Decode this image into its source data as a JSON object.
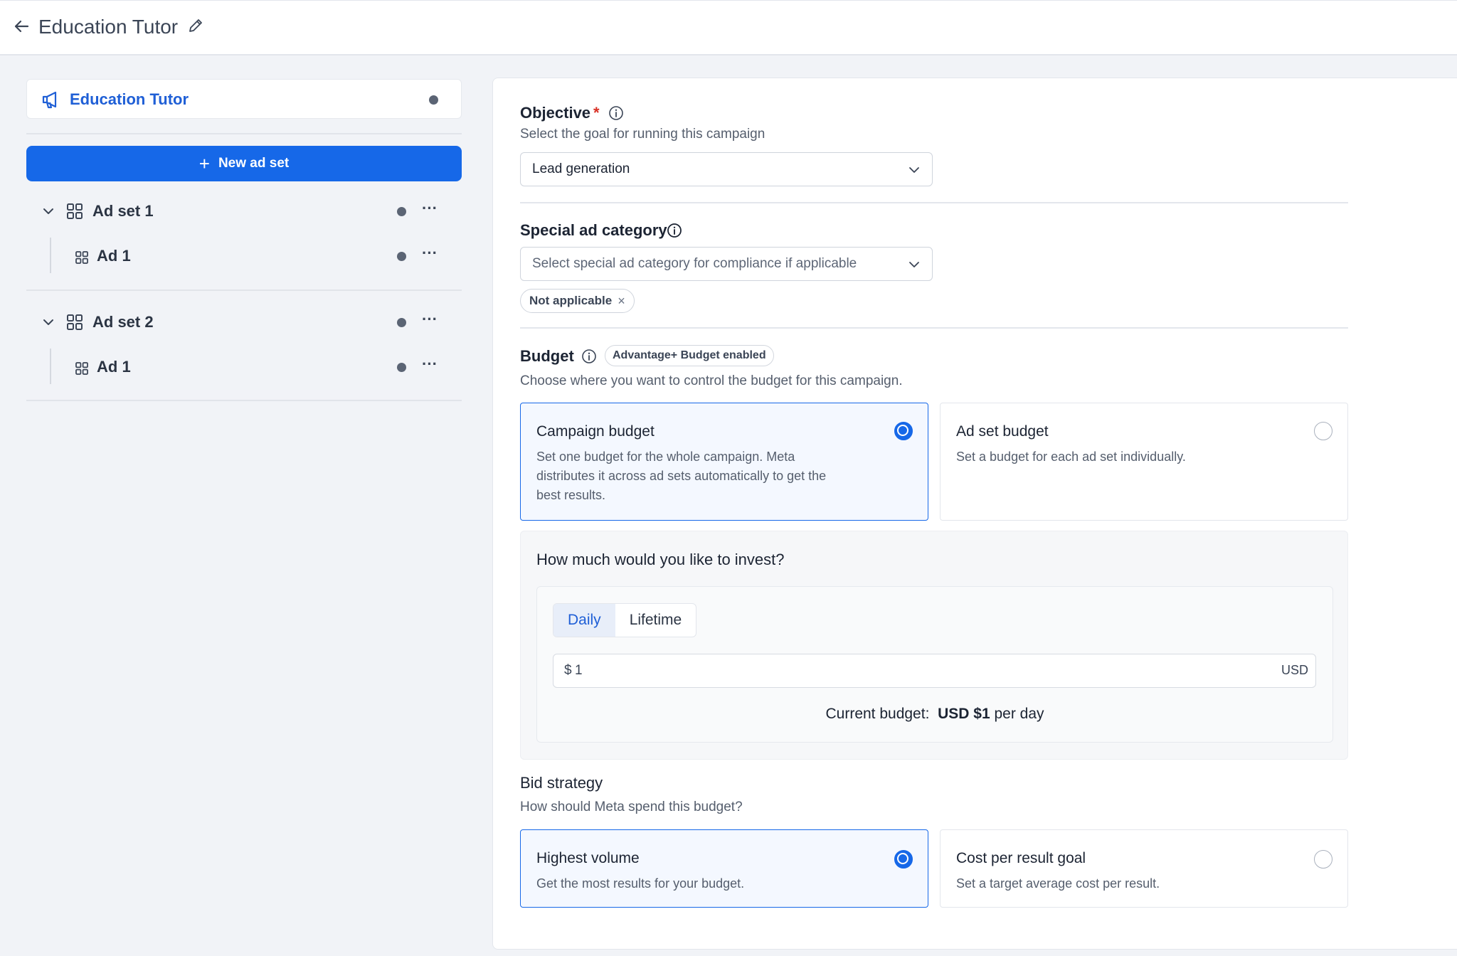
{
  "header": {
    "title": "Education Tutor",
    "back_icon": "arrow-left-icon",
    "edit_icon": "pencil-icon"
  },
  "sidebar": {
    "campaign_name": "Education Tutor",
    "new_ad_set_label": "New ad set",
    "ad_sets": [
      {
        "label": "Ad set 1",
        "ads": [
          {
            "label": "Ad 1"
          }
        ]
      },
      {
        "label": "Ad set 2",
        "ads": [
          {
            "label": "Ad 1"
          }
        ]
      }
    ],
    "more_label": "···"
  },
  "objective": {
    "label": "Objective",
    "required_mark": "*",
    "subtitle": "Select the goal for running this campaign",
    "selected": "Lead generation"
  },
  "special_category": {
    "label": "Special ad category",
    "placeholder": "Select special ad category for compliance if applicable",
    "chip": "Not applicable",
    "chip_remove": "×"
  },
  "budget": {
    "label": "Budget",
    "badge": "Advantage+ Budget enabled",
    "subtitle": "Choose where you want to control the budget for this campaign.",
    "options": [
      {
        "title": "Campaign budget",
        "desc": [
          "Set one budget for the whole campaign. Meta",
          "distributes it across ad sets automatically to get the",
          "best results."
        ],
        "selected": true
      },
      {
        "title": "Ad set budget",
        "desc": [
          "Set a budget for each ad set individually."
        ],
        "selected": false
      }
    ],
    "invest_question": "How much would you like to invest?",
    "tabs": [
      "Daily",
      "Lifetime"
    ],
    "active_tab": "Daily",
    "currency_symbol": "$",
    "amount": "1",
    "currency": "USD",
    "current_prefix": "Current budget:",
    "current_value": "USD $1",
    "current_suffix": "per day"
  },
  "bid": {
    "label": "Bid strategy",
    "subtitle": "How should Meta spend this budget?",
    "options": [
      {
        "title": "Highest volume",
        "desc": "Get the most results for your budget.",
        "selected": true
      },
      {
        "title": "Cost per result goal",
        "desc": "Set a target average cost per result.",
        "selected": false
      }
    ]
  },
  "colors": {
    "accent": "#1668e8",
    "link": "#1f5fd6",
    "required": "#d93025"
  }
}
